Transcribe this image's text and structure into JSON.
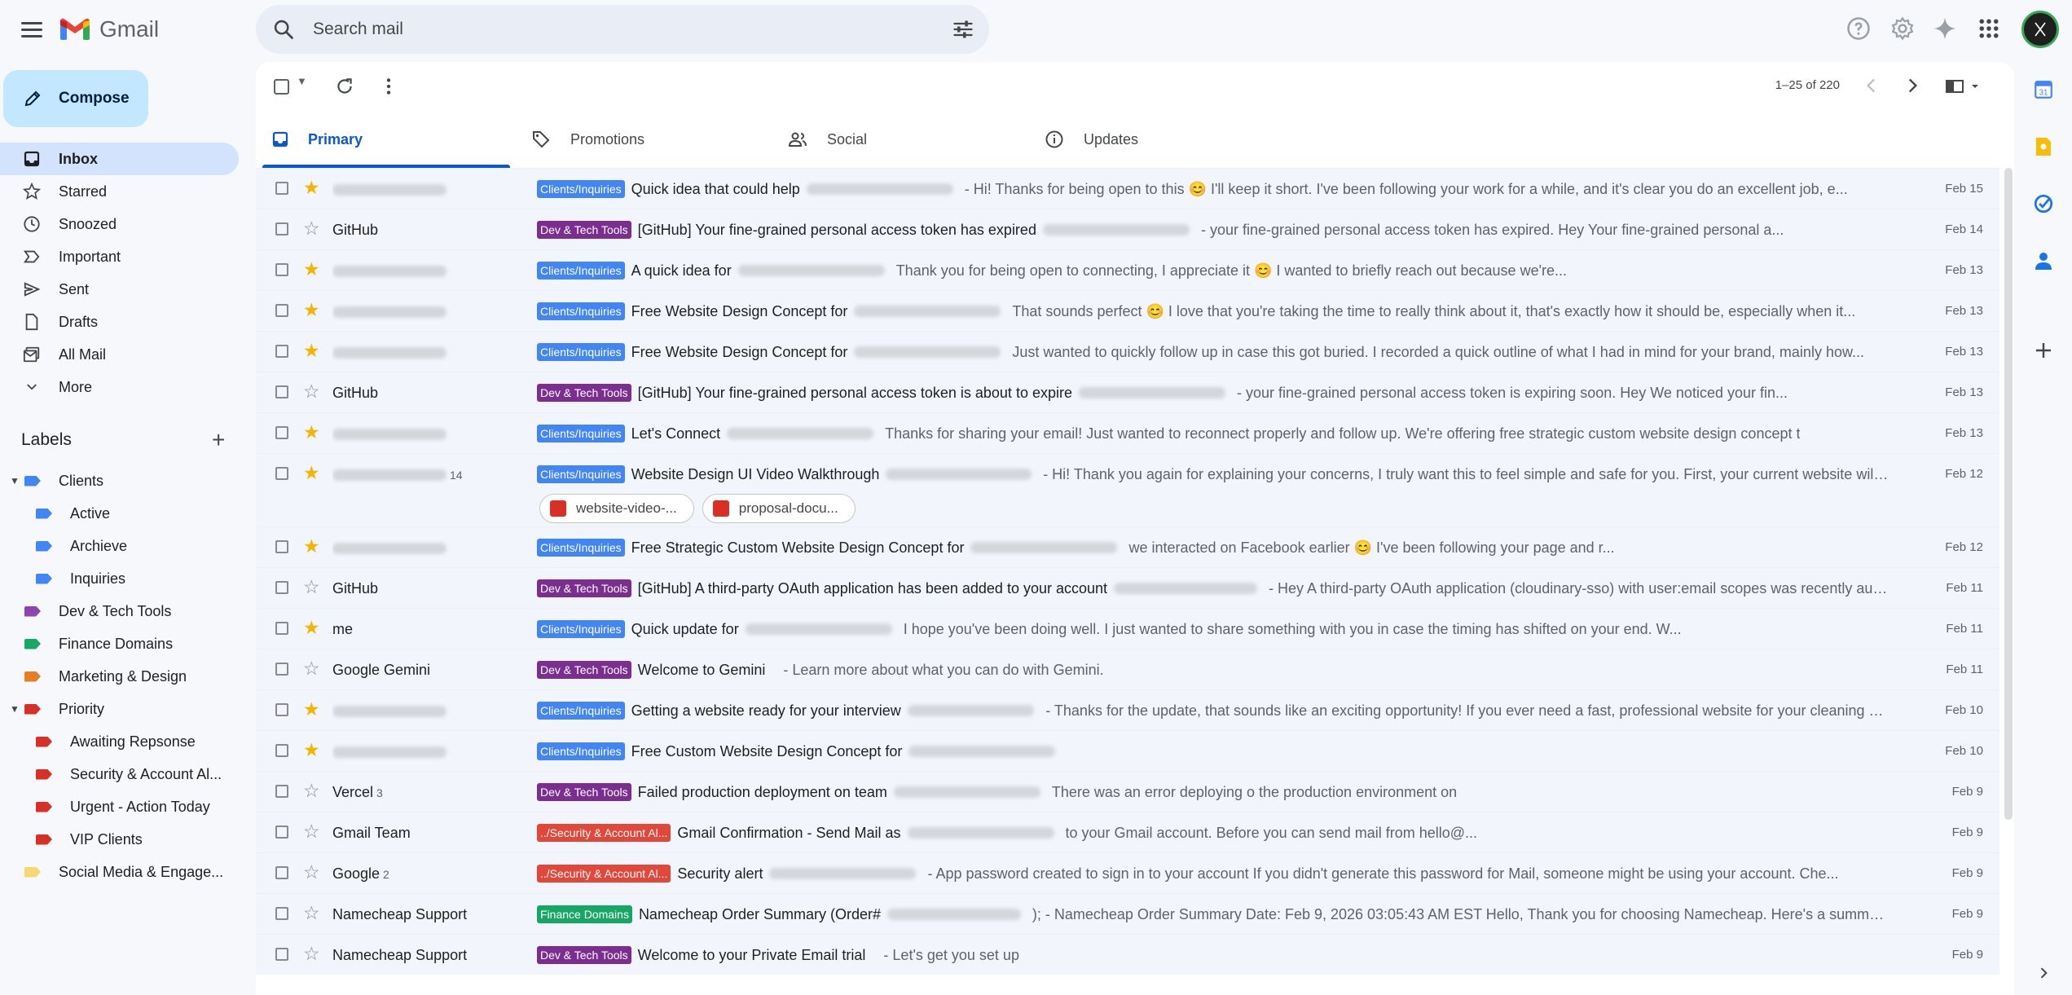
{
  "app": {
    "name": "Gmail"
  },
  "search": {
    "placeholder": "Search mail"
  },
  "compose_label": "Compose",
  "nav": [
    {
      "label": "Inbox",
      "icon": "inbox-icon",
      "active": true
    },
    {
      "label": "Starred",
      "icon": "star-icon"
    },
    {
      "label": "Snoozed",
      "icon": "clock-icon"
    },
    {
      "label": "Important",
      "icon": "important-icon"
    },
    {
      "label": "Sent",
      "icon": "send-icon"
    },
    {
      "label": "Drafts",
      "icon": "draft-icon"
    },
    {
      "label": "All Mail",
      "icon": "all-mail-icon"
    },
    {
      "label": "More",
      "icon": "chevron-down-icon"
    }
  ],
  "labels_header": "Labels",
  "labels": [
    {
      "label": "Clients",
      "color": "#4285f4",
      "level": 0,
      "expanded": true
    },
    {
      "label": "Active",
      "color": "#4285f4",
      "level": 1
    },
    {
      "label": "Archieve",
      "color": "#4285f4",
      "level": 1
    },
    {
      "label": "Inquiries",
      "color": "#4285f4",
      "level": 1
    },
    {
      "label": "Dev & Tech Tools",
      "color": "#8e44ad",
      "level": 0
    },
    {
      "label": "Finance Domains",
      "color": "#16a765",
      "level": 0
    },
    {
      "label": "Marketing & Design",
      "color": "#e67e22",
      "level": 0
    },
    {
      "label": "Priority",
      "color": "#d93025",
      "level": 0,
      "expanded": true
    },
    {
      "label": "Awaiting Repsonse",
      "color": "#d93025",
      "level": 1
    },
    {
      "label": "Security & Account Al...",
      "color": "#d93025",
      "level": 1
    },
    {
      "label": "Urgent - Action Today",
      "color": "#d93025",
      "level": 1
    },
    {
      "label": "VIP Clients",
      "color": "#d93025",
      "level": 1
    },
    {
      "label": "Social Media & Engage...",
      "color": "#f7d774",
      "level": 0
    }
  ],
  "pager": {
    "text": "1–25 of 220"
  },
  "tabs": [
    {
      "label": "Primary",
      "icon": "inbox-icon",
      "active": true
    },
    {
      "label": "Promotions",
      "icon": "tag-icon"
    },
    {
      "label": "Social",
      "icon": "people-icon"
    },
    {
      "label": "Updates",
      "icon": "info-icon"
    }
  ],
  "badge_colors": {
    "Clients/Inquiries": "#4285f4",
    "Dev & Tech Tools": "#7b2d90",
    "../Security & Account Al...": "#e1483a",
    "Finance Domains": "#16a765"
  },
  "emails": [
    {
      "sender": "",
      "starred": true,
      "badge": "Clients/Inquiries",
      "subject": "Quick idea that could help",
      "snippet": "- Hi! Thanks for being open to this 😊 I'll keep it short. I've been following your work for a while, and it's clear you do an excellent job, e...",
      "date": "Feb 15",
      "bg": "read"
    },
    {
      "sender": "GitHub",
      "starred": false,
      "badge": "Dev & Tech Tools",
      "subject": "[GitHub] Your fine-grained personal access token has expired",
      "snippet": "- your fine-grained personal access token has expired. Hey Your fine-grained personal a...",
      "date": "Feb 14",
      "bg": "read"
    },
    {
      "sender": "",
      "starred": true,
      "badge": "Clients/Inquiries",
      "subject": "A quick idea for",
      "snippet": "Thank you for being open to connecting, I appreciate it 😊 I wanted to briefly reach out because we're...",
      "date": "Feb 13",
      "bg": "read"
    },
    {
      "sender": "",
      "starred": true,
      "badge": "Clients/Inquiries",
      "subject": "Free Website Design Concept for",
      "snippet": "That sounds perfect 😊 I love that you're taking the time to really think about it, that's exactly how it should be, especially when it...",
      "date": "Feb 13",
      "bg": "read"
    },
    {
      "sender": "",
      "starred": true,
      "badge": "Clients/Inquiries",
      "subject": "Free Website Design Concept for",
      "snippet": "Just wanted to quickly follow up in case this got buried. I recorded a quick outline of what I had in mind for your brand, mainly how...",
      "date": "Feb 13",
      "bg": "read"
    },
    {
      "sender": "GitHub",
      "starred": false,
      "badge": "Dev & Tech Tools",
      "subject": "[GitHub] Your fine-grained personal access token is about to expire",
      "snippet": "- your fine-grained personal access token is expiring soon. Hey We noticed your fin...",
      "date": "Feb 13",
      "bg": "read"
    },
    {
      "sender": "",
      "starred": true,
      "badge": "Clients/Inquiries",
      "subject": "Let's Connect",
      "snippet": "Thanks for sharing your email! Just wanted to reconnect properly and follow up. We're offering free strategic custom website design concept t",
      "date": "Feb 13",
      "bg": "read"
    },
    {
      "sender": "",
      "count": "14",
      "starred": true,
      "badge": "Clients/Inquiries",
      "subject": "Website Design UI Video Walkthrough",
      "snippet": "- Hi! Thank you again for explaining your concerns, I truly want this to feel simple and safe for you. First, your current website will r...",
      "date": "Feb 12",
      "bg": "read",
      "attachments": [
        "website-video-...",
        "proposal-docu..."
      ]
    },
    {
      "sender": "",
      "starred": true,
      "badge": "Clients/Inquiries",
      "subject": "Free Strategic Custom Website Design Concept for",
      "snippet": "we interacted on Facebook earlier 😊 I've been following your page and r...",
      "date": "Feb 12",
      "bg": "read"
    },
    {
      "sender": "GitHub",
      "starred": false,
      "badge": "Dev & Tech Tools",
      "subject": "[GitHub] A third-party OAuth application has been added to your account",
      "snippet": "- Hey A third-party OAuth application (cloudinary-sso) with user:email scopes was recently autho...",
      "date": "Feb 11",
      "bg": "read"
    },
    {
      "sender": "me",
      "starred": true,
      "badge": "Clients/Inquiries",
      "subject": "Quick update for",
      "snippet": "I hope you've been doing well. I just wanted to share something with you in case the timing has shifted on your end. W...",
      "date": "Feb 11",
      "bg": "read"
    },
    {
      "sender": "Google Gemini",
      "starred": false,
      "badge": "Dev & Tech Tools",
      "subject": "Welcome to Gemini",
      "snippet": "- Learn more about what you can do with Gemini.",
      "date": "Feb 11",
      "bg": "read"
    },
    {
      "sender": "",
      "starred": true,
      "badge": "Clients/Inquiries",
      "subject": "Getting a website ready for your interview",
      "snippet": "- Thanks for the update, that sounds like an exciting opportunity! If you ever need a fast, professional website for your cleaning business to showcase...",
      "date": "Feb 10",
      "bg": "read"
    },
    {
      "sender": "",
      "starred": true,
      "badge": "Clients/Inquiries",
      "subject": "Free Custom Website Design Concept for",
      "snippet": "",
      "date": "Feb 10",
      "bg": "read"
    },
    {
      "sender": "Vercel",
      "count": "3",
      "starred": false,
      "badge": "Dev & Tech Tools",
      "subject": "Failed production deployment on team",
      "snippet": "There was an error deploying o the production environment on",
      "date": "Feb 9",
      "bg": "read"
    },
    {
      "sender": "Gmail Team",
      "starred": false,
      "badge": "../Security & Account Al...",
      "subject": "Gmail Confirmation - Send Mail as",
      "snippet": "to your Gmail account. Before you can send mail from hello@...",
      "date": "Feb 9",
      "bg": "read"
    },
    {
      "sender": "Google",
      "count": "2",
      "starred": false,
      "badge": "../Security & Account Al...",
      "subject": "Security alert",
      "snippet": "- App password created to sign in to your account If you didn't generate this password for Mail, someone might be using your account. Che...",
      "date": "Feb 9",
      "bg": "read"
    },
    {
      "sender": "Namecheap Support",
      "starred": false,
      "badge": "Finance Domains",
      "subject": "Namecheap Order Summary (Order#",
      "snippet": "); - Namecheap Order Summary Date: Feb 9, 2026 03:05:43 AM EST Hello, Thank you for choosing Namecheap. Here's a summary of your ord...",
      "date": "Feb 9",
      "bg": "read"
    },
    {
      "sender": "Namecheap Support",
      "starred": false,
      "badge": "Dev & Tech Tools",
      "subject": "Welcome to your Private Email trial",
      "snippet": "- Let's get you set up",
      "date": "Feb 9",
      "bg": "read"
    }
  ]
}
